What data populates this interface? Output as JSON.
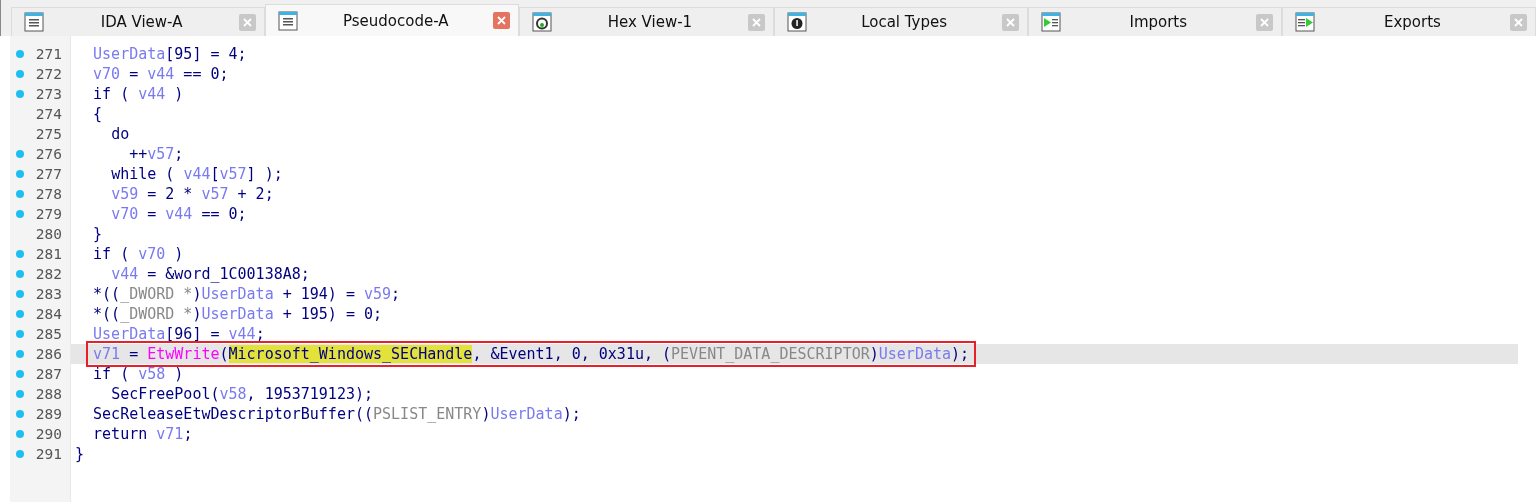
{
  "tabs": [
    {
      "label": "IDA View-A",
      "kind": "listing",
      "selected": false
    },
    {
      "label": "Pseudocode-A",
      "kind": "listing",
      "selected": true
    },
    {
      "label": "Hex View-1",
      "kind": "hex",
      "selected": false
    },
    {
      "label": "Local Types",
      "kind": "types",
      "selected": false
    },
    {
      "label": "Imports",
      "kind": "imports",
      "selected": false
    },
    {
      "label": "Exports",
      "kind": "exports",
      "selected": false
    }
  ],
  "code": {
    "lines": [
      {
        "number": "271",
        "dot": true,
        "tokens": [
          {
            "text": "  UserData",
            "kind": "var"
          },
          {
            "text": "[95] = 4;",
            "kind": "plain"
          }
        ]
      },
      {
        "number": "272",
        "dot": true,
        "tokens": [
          {
            "text": "  v70",
            "kind": "var"
          },
          {
            "text": " = ",
            "kind": "plain"
          },
          {
            "text": "v44",
            "kind": "var"
          },
          {
            "text": " == 0;",
            "kind": "plain"
          }
        ]
      },
      {
        "number": "273",
        "dot": true,
        "tokens": [
          {
            "text": "  if ( ",
            "kind": "plain"
          },
          {
            "text": "v44",
            "kind": "var"
          },
          {
            "text": " )",
            "kind": "plain"
          }
        ]
      },
      {
        "number": "274",
        "dot": false,
        "tokens": [
          {
            "text": "  {",
            "kind": "plain"
          }
        ]
      },
      {
        "number": "275",
        "dot": false,
        "tokens": [
          {
            "text": "    do",
            "kind": "plain"
          }
        ]
      },
      {
        "number": "276",
        "dot": true,
        "tokens": [
          {
            "text": "      ++",
            "kind": "plain"
          },
          {
            "text": "v57",
            "kind": "var"
          },
          {
            "text": ";",
            "kind": "plain"
          }
        ]
      },
      {
        "number": "277",
        "dot": true,
        "tokens": [
          {
            "text": "    while ( ",
            "kind": "plain"
          },
          {
            "text": "v44",
            "kind": "var"
          },
          {
            "text": "[",
            "kind": "plain"
          },
          {
            "text": "v57",
            "kind": "var"
          },
          {
            "text": "] );",
            "kind": "plain"
          }
        ]
      },
      {
        "number": "278",
        "dot": true,
        "tokens": [
          {
            "text": "    v59",
            "kind": "var"
          },
          {
            "text": " = 2 * ",
            "kind": "plain"
          },
          {
            "text": "v57",
            "kind": "var"
          },
          {
            "text": " + 2;",
            "kind": "plain"
          }
        ]
      },
      {
        "number": "279",
        "dot": true,
        "tokens": [
          {
            "text": "    v70",
            "kind": "var"
          },
          {
            "text": " = ",
            "kind": "plain"
          },
          {
            "text": "v44",
            "kind": "var"
          },
          {
            "text": " == 0;",
            "kind": "plain"
          }
        ]
      },
      {
        "number": "280",
        "dot": false,
        "tokens": [
          {
            "text": "  }",
            "kind": "plain"
          }
        ]
      },
      {
        "number": "281",
        "dot": true,
        "tokens": [
          {
            "text": "  if ( ",
            "kind": "plain"
          },
          {
            "text": "v70",
            "kind": "var"
          },
          {
            "text": " )",
            "kind": "plain"
          }
        ]
      },
      {
        "number": "282",
        "dot": true,
        "tokens": [
          {
            "text": "    v44",
            "kind": "var"
          },
          {
            "text": " = &word_1C00138A8;",
            "kind": "plain"
          }
        ]
      },
      {
        "number": "283",
        "dot": true,
        "tokens": [
          {
            "text": "  *((",
            "kind": "plain"
          },
          {
            "text": "_DWORD *",
            "kind": "type"
          },
          {
            "text": ")",
            "kind": "plain"
          },
          {
            "text": "UserData",
            "kind": "var"
          },
          {
            "text": " + 194) = ",
            "kind": "plain"
          },
          {
            "text": "v59",
            "kind": "var"
          },
          {
            "text": ";",
            "kind": "plain"
          }
        ]
      },
      {
        "number": "284",
        "dot": true,
        "tokens": [
          {
            "text": "  *((",
            "kind": "plain"
          },
          {
            "text": "_DWORD *",
            "kind": "type"
          },
          {
            "text": ")",
            "kind": "plain"
          },
          {
            "text": "UserData",
            "kind": "var"
          },
          {
            "text": " + 195) = 0;",
            "kind": "plain"
          }
        ]
      },
      {
        "number": "285",
        "dot": true,
        "tokens": [
          {
            "text": "  UserData",
            "kind": "var"
          },
          {
            "text": "[96] = ",
            "kind": "plain"
          },
          {
            "text": "v44",
            "kind": "var"
          },
          {
            "text": ";",
            "kind": "plain"
          }
        ]
      },
      {
        "number": "286",
        "dot": true,
        "current": true,
        "boxed": true,
        "tokens": [
          {
            "text": "  v71",
            "kind": "var"
          },
          {
            "text": " = ",
            "kind": "plain"
          },
          {
            "text": "EtwWrite",
            "kind": "import"
          },
          {
            "text": "(",
            "kind": "plain"
          },
          {
            "text": "Microsoft_Windows_SECHandle",
            "kind": "plain",
            "highlighted": true
          },
          {
            "text": ", &Event1, 0, 0x31u, (",
            "kind": "plain"
          },
          {
            "text": "PEVENT_DATA_DESCRIPTOR",
            "kind": "type"
          },
          {
            "text": ")",
            "kind": "plain"
          },
          {
            "text": "UserData",
            "kind": "var"
          },
          {
            "text": ");",
            "kind": "plain"
          }
        ]
      },
      {
        "number": "287",
        "dot": true,
        "tokens": [
          {
            "text": "  if ( ",
            "kind": "plain"
          },
          {
            "text": "v58",
            "kind": "var"
          },
          {
            "text": " )",
            "kind": "plain"
          }
        ]
      },
      {
        "number": "288",
        "dot": true,
        "tokens": [
          {
            "text": "    SecFreePool(",
            "kind": "plain"
          },
          {
            "text": "v58",
            "kind": "var"
          },
          {
            "text": ", 1953719123);",
            "kind": "plain"
          }
        ]
      },
      {
        "number": "289",
        "dot": true,
        "tokens": [
          {
            "text": "  SecReleaseEtwDescriptorBuffer((",
            "kind": "plain"
          },
          {
            "text": "PSLIST_ENTRY",
            "kind": "type"
          },
          {
            "text": ")",
            "kind": "plain"
          },
          {
            "text": "UserData",
            "kind": "var"
          },
          {
            "text": ");",
            "kind": "plain"
          }
        ]
      },
      {
        "number": "290",
        "dot": true,
        "tokens": [
          {
            "text": "  return ",
            "kind": "plain"
          },
          {
            "text": "v71",
            "kind": "var"
          },
          {
            "text": ";",
            "kind": "plain"
          }
        ]
      },
      {
        "number": "291",
        "dot": true,
        "tokens": [
          {
            "text": "}",
            "kind": "plain"
          }
        ]
      }
    ]
  }
}
